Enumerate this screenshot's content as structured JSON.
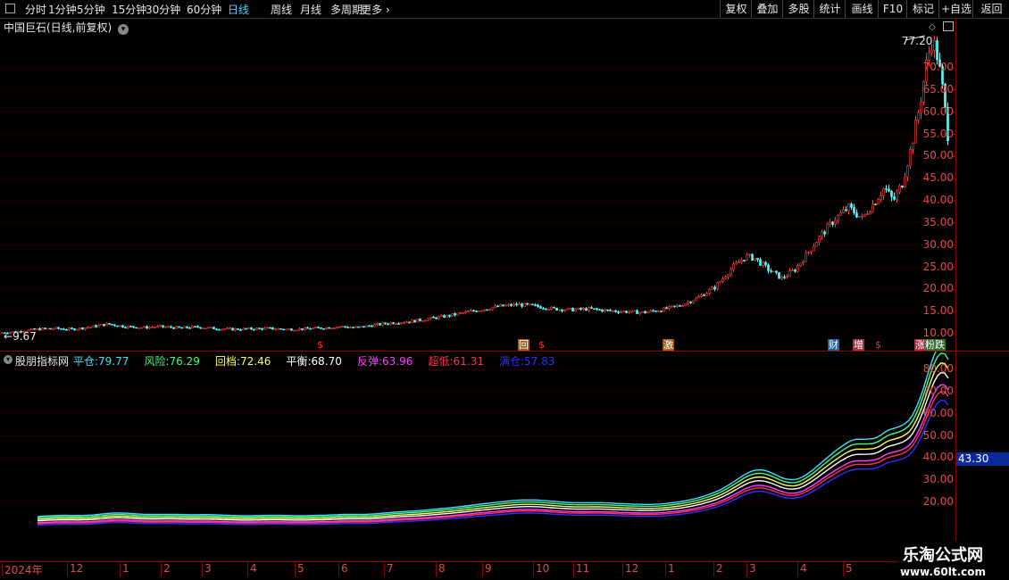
{
  "toolbar": {
    "periods": [
      "分时",
      "1分钟",
      "5分钟",
      "15分钟",
      "30分钟",
      "60分钟",
      "日线",
      "周线",
      "月线",
      "多周期",
      "更多"
    ],
    "active_period": "日线",
    "right_buttons": [
      "复权",
      "叠加",
      "多股",
      "统计",
      "画线",
      "F10",
      "标记",
      "+自选",
      "返回"
    ]
  },
  "main_panel": {
    "title": "中国巨石(日线,前复权)",
    "high_label": "77.20",
    "low_label": "9.67",
    "y_ticks": [
      "70.00",
      "65.00",
      "60.00",
      "55.00",
      "50.00",
      "45.00",
      "40.00",
      "35.00",
      "30.00",
      "25.00",
      "20.00",
      "15.00",
      "10.00"
    ],
    "markers": [
      {
        "text": "$",
        "color": "#ff3030",
        "bg": "transparent"
      },
      {
        "text": "回",
        "color": "#ffffff",
        "bg": "#a05a10"
      },
      {
        "text": "$",
        "color": "#ff3030",
        "bg": "transparent"
      },
      {
        "text": "激",
        "color": "#ffffff",
        "bg": "#a05a10"
      },
      {
        "text": "财",
        "color": "#ffffff",
        "bg": "#2060a0"
      },
      {
        "text": "增",
        "color": "#ffffff",
        "bg": "#a03040"
      },
      {
        "text": "$",
        "color": "#ff3030",
        "bg": "transparent"
      },
      {
        "text": "涨",
        "color": "#ffffff",
        "bg": "#a03040"
      },
      {
        "text": "粉",
        "color": "#ffffff",
        "bg": "#2e6d2e"
      },
      {
        "text": "跌",
        "color": "#ffffff",
        "bg": "#2e6d2e"
      }
    ]
  },
  "indicator_panel": {
    "name": "股朋指标网",
    "legend": [
      {
        "label": "平仓:",
        "value": "79.77",
        "color": "#40e0ff"
      },
      {
        "label": "风险:",
        "value": "76.29",
        "color": "#40ff80"
      },
      {
        "label": "回档:",
        "value": "72.46",
        "color": "#ffff60"
      },
      {
        "label": "平衡:",
        "value": "68.70",
        "color": "#ffffff"
      },
      {
        "label": "反弹:",
        "value": "63.96",
        "color": "#ff40ff"
      },
      {
        "label": "超低:",
        "value": "61.31",
        "color": "#ff3050"
      },
      {
        "label": "满仓:",
        "value": "57.83",
        "color": "#3030ff"
      }
    ],
    "y_ticks": [
      "80.00",
      "70.00",
      "60.00",
      "50.00",
      "40.00",
      "30.00",
      "20.00"
    ],
    "current_value": "43.30"
  },
  "x_axis": {
    "labels": [
      "2024年",
      "12",
      "1",
      "2",
      "3",
      "4",
      "5",
      "6",
      "7",
      "8",
      "9",
      "10",
      "11",
      "12",
      "1",
      "2",
      "3",
      "4",
      "5"
    ]
  },
  "watermark": {
    "line1": "乐淘公式网",
    "line2": "www.60lt.com"
  },
  "chart_data": {
    "type": "candlestick",
    "ylim": [
      8,
      80
    ],
    "overview_price_path": [
      [
        0,
        10.2
      ],
      [
        20,
        10.5
      ],
      [
        40,
        11.0
      ],
      [
        60,
        11.2
      ],
      [
        80,
        11.0
      ],
      [
        100,
        11.5
      ],
      [
        120,
        12.2
      ],
      [
        140,
        11.6
      ],
      [
        160,
        11.4
      ],
      [
        180,
        11.6
      ],
      [
        200,
        11.3
      ],
      [
        220,
        11.5
      ],
      [
        240,
        11.2
      ],
      [
        260,
        11.0
      ],
      [
        280,
        11.1
      ],
      [
        300,
        11.2
      ],
      [
        320,
        11.0
      ],
      [
        340,
        11.1
      ],
      [
        360,
        11.3
      ],
      [
        380,
        11.6
      ],
      [
        400,
        11.4
      ],
      [
        420,
        12.0
      ],
      [
        440,
        12.5
      ],
      [
        460,
        12.8
      ],
      [
        480,
        13.4
      ],
      [
        500,
        14.0
      ],
      [
        520,
        14.8
      ],
      [
        540,
        15.5
      ],
      [
        560,
        16.2
      ],
      [
        580,
        16.6
      ],
      [
        600,
        16.2
      ],
      [
        620,
        15.6
      ],
      [
        640,
        15.4
      ],
      [
        660,
        15.6
      ],
      [
        680,
        15.2
      ],
      [
        700,
        15.0
      ],
      [
        720,
        14.8
      ],
      [
        740,
        15.4
      ],
      [
        760,
        16.3
      ],
      [
        780,
        18.0
      ],
      [
        800,
        20.5
      ],
      [
        820,
        25.0
      ],
      [
        835,
        27.5
      ],
      [
        845,
        27.0
      ],
      [
        860,
        24.5
      ],
      [
        875,
        22.5
      ],
      [
        890,
        24.5
      ],
      [
        905,
        28.5
      ],
      [
        920,
        32.5
      ],
      [
        935,
        36.0
      ],
      [
        950,
        38.5
      ],
      [
        965,
        36.0
      ],
      [
        980,
        40.0
      ],
      [
        990,
        43.0
      ],
      [
        1000,
        40.0
      ],
      [
        1010,
        44.0
      ],
      [
        1020,
        52.0
      ],
      [
        1030,
        62.0
      ],
      [
        1038,
        72.0
      ],
      [
        1044,
        76.5
      ],
      [
        1050,
        72.0
      ],
      [
        1056,
        64.0
      ],
      [
        1062,
        53.0
      ]
    ],
    "indicator_lines": {
      "平仓": 79.77,
      "风险": 76.29,
      "回档": 72.46,
      "平衡": 68.7,
      "反弹": 63.96,
      "超低": 61.31,
      "满仓": 57.83
    }
  }
}
